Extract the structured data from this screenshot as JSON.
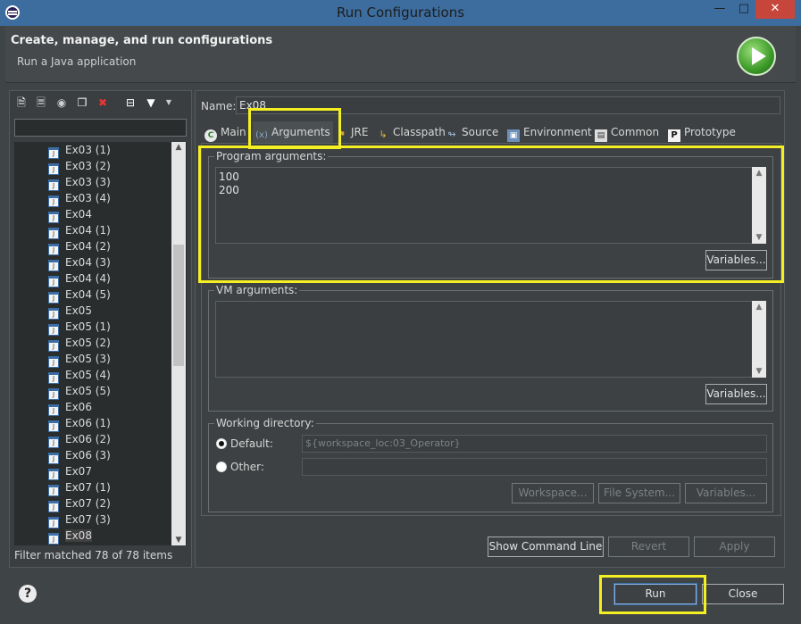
{
  "window": {
    "title": "Run Configurations",
    "minimize_icon": "minimize-icon",
    "maximize_icon": "maximize-icon",
    "close_icon": "close-icon"
  },
  "banner": {
    "title": "Create, manage, and run configurations",
    "subtitle": "Run a Java application"
  },
  "left": {
    "toolbar_icons": [
      "new-configuration-icon",
      "new-prototype-icon",
      "export-icon",
      "duplicate-icon",
      "delete-icon",
      "collapse-all-icon",
      "filter-icon",
      "view-menu-icon"
    ],
    "filter_placeholder": "",
    "items": [
      "Ex03 (1)",
      "Ex03 (2)",
      "Ex03 (3)",
      "Ex03 (4)",
      "Ex04",
      "Ex04 (1)",
      "Ex04 (2)",
      "Ex04 (3)",
      "Ex04 (4)",
      "Ex04 (5)",
      "Ex05",
      "Ex05 (1)",
      "Ex05 (2)",
      "Ex05 (3)",
      "Ex05 (4)",
      "Ex05 (5)",
      "Ex06",
      "Ex06 (1)",
      "Ex06 (2)",
      "Ex06 (3)",
      "Ex07",
      "Ex07 (1)",
      "Ex07 (2)",
      "Ex07 (3)",
      "Ex08"
    ],
    "selected": "Ex08",
    "status": "Filter matched 78 of 78 items"
  },
  "right": {
    "name_label": "Name:",
    "name_value": "Ex08",
    "tabs": [
      {
        "label": "Main",
        "icon": "main-tab-icon"
      },
      {
        "label": "Arguments",
        "icon": "arguments-tab-icon"
      },
      {
        "label": "JRE",
        "icon": "jre-tab-icon"
      },
      {
        "label": "Classpath",
        "icon": "classpath-tab-icon"
      },
      {
        "label": "Source",
        "icon": "source-tab-icon"
      },
      {
        "label": "Environment",
        "icon": "environment-tab-icon"
      },
      {
        "label": "Common",
        "icon": "common-tab-icon"
      },
      {
        "label": "Prototype",
        "icon": "prototype-tab-icon"
      }
    ],
    "active_tab": "Arguments",
    "program_args": {
      "label": "Program arguments:",
      "value": "100\n200",
      "variables_button": "Variables..."
    },
    "vm_args": {
      "label": "VM arguments:",
      "value": "",
      "variables_button": "Variables..."
    },
    "working_dir": {
      "label": "Working directory:",
      "default_label": "Default:",
      "default_value": "${workspace_loc:03_Operator}",
      "other_label": "Other:",
      "other_value": "",
      "selected": "Default",
      "workspace_button": "Workspace...",
      "filesystem_button": "File System...",
      "variables_button": "Variables..."
    },
    "show_command_line": "Show Command Line",
    "revert": "Revert",
    "apply": "Apply"
  },
  "footer": {
    "run": "Run",
    "close": "Close",
    "help_icon": "help-icon"
  },
  "colors": {
    "highlight": "#f4ef22",
    "titlebar": "#3c6d9e",
    "close_button": "#c7463b",
    "background": "#3f4446"
  }
}
